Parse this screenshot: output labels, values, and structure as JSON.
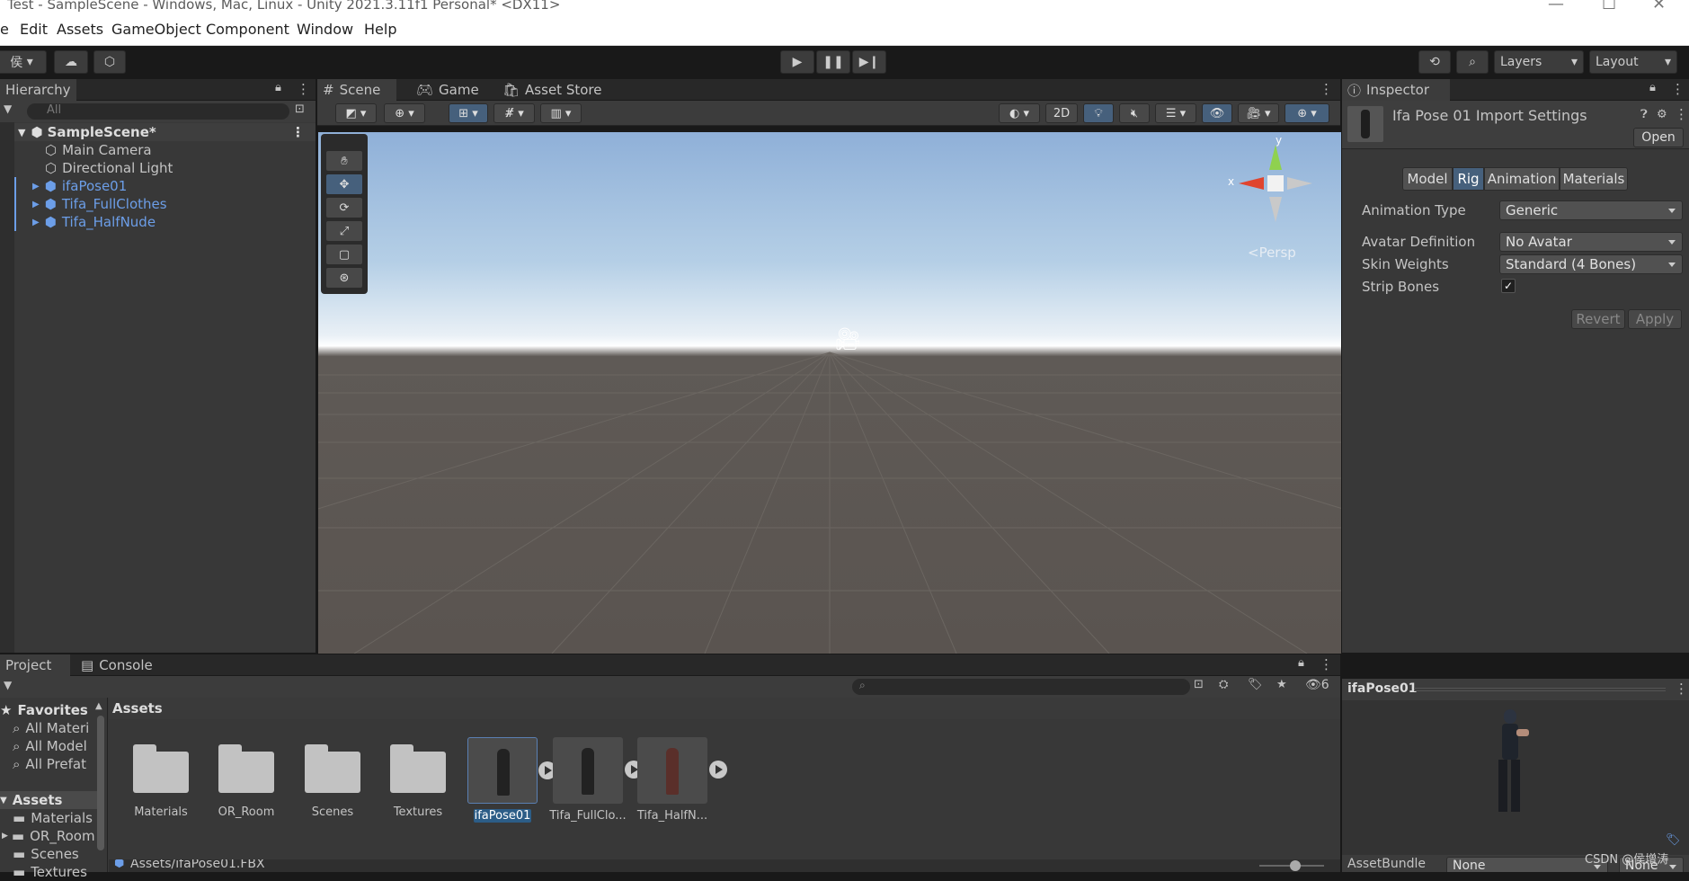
{
  "window": {
    "title": "Test - SampleScene - Windows, Mac, Linux - Unity 2021.3.11f1 Personal* <DX11>"
  },
  "menu": [
    "e",
    "Edit",
    "Assets",
    "GameObject",
    "Component",
    "Window",
    "Help"
  ],
  "toolbar": {
    "account_label": "侯",
    "layers_label": "Layers",
    "layout_label": "Layout"
  },
  "hierarchy": {
    "tab": "Hierarchy",
    "search_placeholder": "All",
    "scene": "SampleScene*",
    "items": [
      "Main Camera",
      "Directional Light",
      "ifaPose01",
      "Tifa_FullClothes",
      "Tifa_HalfNude"
    ]
  },
  "scene_view": {
    "tabs": [
      "Scene",
      "Game",
      "Asset Store"
    ],
    "btn_2d": "2D",
    "persp": "<Persp",
    "axis_x": "x",
    "axis_y": "y"
  },
  "inspector": {
    "tab": "Inspector",
    "title": "Ifa Pose 01 Import Settings",
    "open": "Open",
    "tabs": [
      "Model",
      "Rig",
      "Animation",
      "Materials"
    ],
    "active_tab": "Rig",
    "fields": [
      {
        "label": "Animation Type",
        "value": "Generic"
      },
      {
        "label": "Avatar Definition",
        "value": "No Avatar"
      },
      {
        "label": "Skin Weights",
        "value": "Standard (4 Bones)"
      }
    ],
    "strip_bones_label": "Strip Bones",
    "strip_bones_checked": true,
    "revert": "Revert",
    "apply": "Apply"
  },
  "project": {
    "tabs": [
      "Project",
      "Console"
    ],
    "favorites_label": "Favorites",
    "favorites": [
      "All Materi",
      "All Model",
      "All Prefat"
    ],
    "assets_label": "Assets",
    "tree": [
      "Materials",
      "OR_Room",
      "Scenes",
      "Textures"
    ],
    "breadcrumb": "Assets",
    "hidden_count": "6",
    "items": [
      {
        "name": "Materials",
        "kind": "folder"
      },
      {
        "name": "OR_Room",
        "kind": "folder"
      },
      {
        "name": "Scenes",
        "kind": "folder"
      },
      {
        "name": "Textures",
        "kind": "folder"
      },
      {
        "name": "ifaPose01",
        "kind": "model",
        "selected": true
      },
      {
        "name": "Tifa_FullClo...",
        "kind": "model"
      },
      {
        "name": "Tifa_HalfN...",
        "kind": "model"
      }
    ],
    "path": "Assets/ifaPose01.FBX"
  },
  "preview": {
    "title": "ifaPose01",
    "assetbundle_label": "AssetBundle",
    "assetbundle_value": "None",
    "variant_value": "None"
  },
  "watermark": "CSDN @侯增涛"
}
